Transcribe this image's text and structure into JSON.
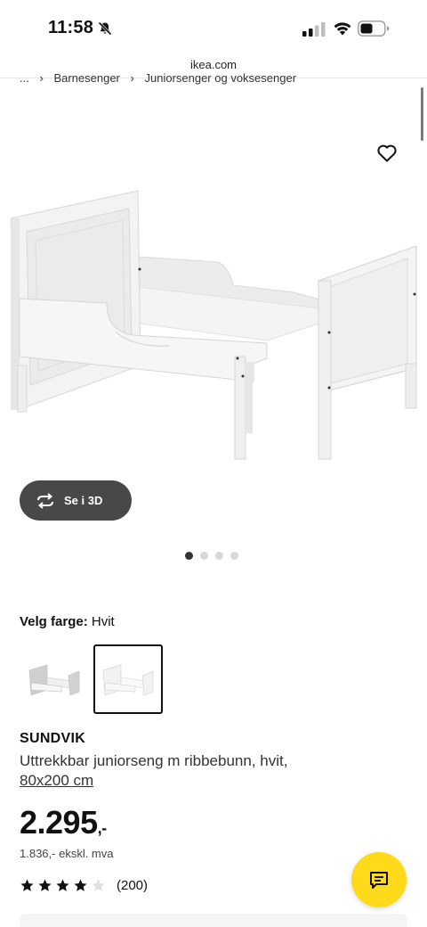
{
  "status_bar": {
    "time": "11:58",
    "icons": [
      "bell-off-icon",
      "signal-icon",
      "wifi-icon",
      "battery-icon"
    ]
  },
  "browser": {
    "url": "ikea.com"
  },
  "breadcrumb": {
    "items": [
      "...",
      "Barnesenger",
      "Juniorsenger og voksesenger"
    ]
  },
  "product": {
    "favorite_icon": "heart-icon",
    "view_3d_label": "Se i 3D",
    "carousel": {
      "count": 4,
      "active": 0
    },
    "color_label": "Velg farge:",
    "color_value": "Hvit",
    "swatches": [
      {
        "name": "grey-white",
        "selected": false
      },
      {
        "name": "white",
        "selected": true
      }
    ],
    "name": "SUNDVIK",
    "description": "Uttrekkbar juniorseng m ribbebunn, hvit,",
    "size": "80x200 cm",
    "price": "2.295",
    "price_suffix": ",-",
    "price_ex_vat": "1.836,- ekskl. mva",
    "rating": {
      "value": 4,
      "max": 5,
      "count_label": "(200)"
    }
  },
  "colors": {
    "chat_fab": "#ffda1a",
    "button_3d": "#484848",
    "text": "#111111"
  }
}
